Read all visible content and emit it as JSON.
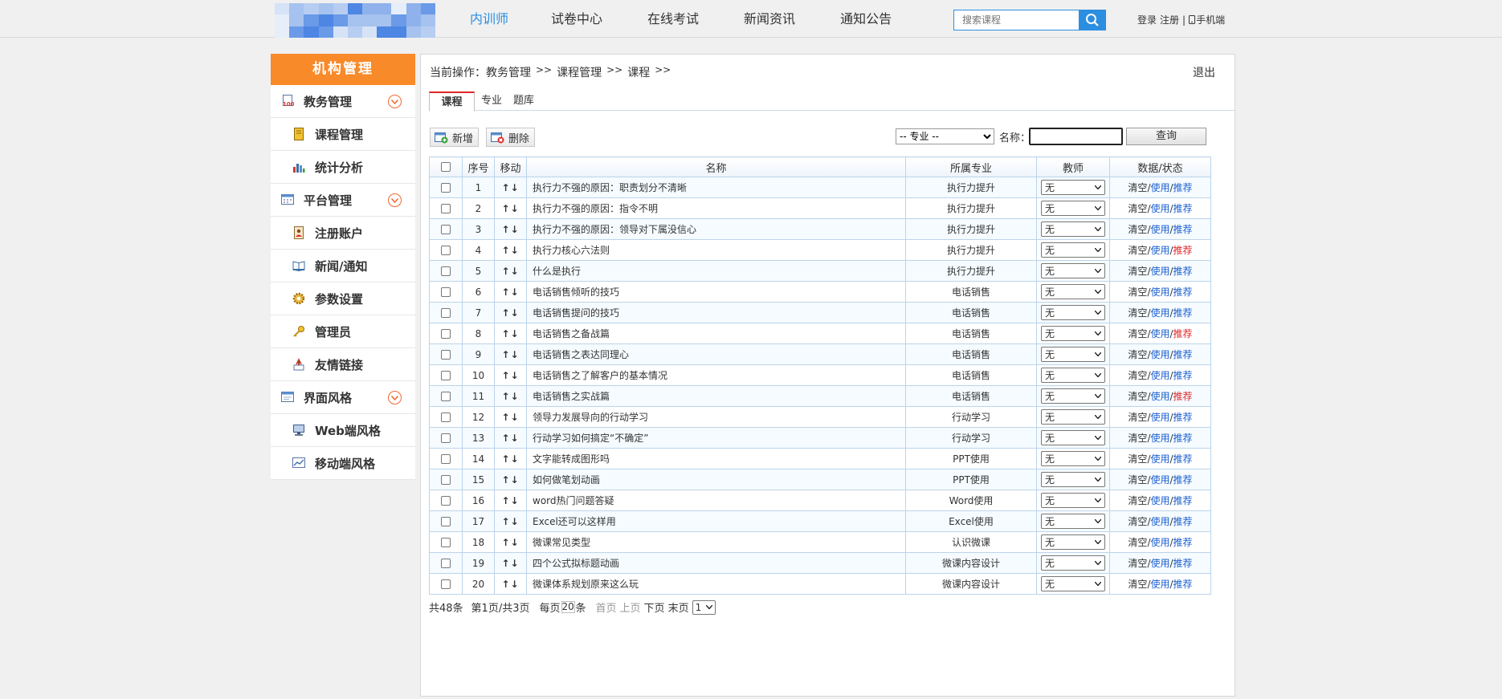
{
  "header": {
    "nav": [
      {
        "label": "内训师",
        "active": true
      },
      {
        "label": "试卷中心",
        "active": false
      },
      {
        "label": "在线考试",
        "active": false
      },
      {
        "label": "新闻资讯",
        "active": false
      },
      {
        "label": "通知公告",
        "active": false
      }
    ],
    "search_placeholder": "搜索课程",
    "login": "登录",
    "register": "注册",
    "divider": "|",
    "mobile": "手机端",
    "accent_color": "#2b8ee0"
  },
  "sidebar": {
    "title": "机构管理",
    "title_color": "#f88a2a",
    "groups": [
      {
        "label": "教务管理",
        "icon": "report-icon",
        "items": [
          {
            "label": "课程管理",
            "icon": "notebook-icon"
          },
          {
            "label": "统计分析",
            "icon": "bar-chart-icon"
          }
        ]
      },
      {
        "label": "平台管理",
        "icon": "calendar-icon",
        "items": [
          {
            "label": "注册账户",
            "icon": "contact-card-icon"
          },
          {
            "label": "新闻/通知",
            "icon": "open-book-icon"
          },
          {
            "label": "参数设置",
            "icon": "gear-icon"
          },
          {
            "label": "管理员",
            "icon": "key-icon"
          },
          {
            "label": "友情链接",
            "icon": "link-icon"
          }
        ]
      },
      {
        "label": "界面风格",
        "icon": "window-icon",
        "items": [
          {
            "label": "Web端风格",
            "icon": "monitor-icon"
          },
          {
            "label": "移动端风格",
            "icon": "line-chart-icon"
          }
        ]
      }
    ]
  },
  "breadcrumb": {
    "prefix": "当前操作：",
    "items": [
      "教务管理",
      "课程管理",
      "课程"
    ],
    "sep": ">>"
  },
  "logout": "退出",
  "tabs": [
    {
      "label": "课程",
      "active": true
    },
    {
      "label": "专业",
      "active": false
    },
    {
      "label": "题库",
      "active": false
    }
  ],
  "toolbar": {
    "add": "新增",
    "delete": "删除",
    "major_select": "-- 专业 --",
    "name_label": "名称：",
    "query": "查询"
  },
  "table": {
    "headers": [
      "",
      "序号",
      "移动",
      "名称",
      "所属专业",
      "教师",
      "数据/状态"
    ],
    "move_glyph": "↑↓",
    "teacher_default": "无",
    "action_clear": "清空",
    "action_use": "使用",
    "action_recommend": "推荐",
    "action_sep": "/",
    "rows": [
      {
        "no": "1",
        "name": "执行力不强的原因：职责划分不清晰",
        "major": "执行力提升",
        "recommended": false
      },
      {
        "no": "2",
        "name": "执行力不强的原因：指令不明",
        "major": "执行力提升",
        "recommended": false
      },
      {
        "no": "3",
        "name": "执行力不强的原因：领导对下属没信心",
        "major": "执行力提升",
        "recommended": false
      },
      {
        "no": "4",
        "name": "执行力核心六法则",
        "major": "执行力提升",
        "recommended": true
      },
      {
        "no": "5",
        "name": "什么是执行",
        "major": "执行力提升",
        "recommended": false
      },
      {
        "no": "6",
        "name": "电话销售倾听的技巧",
        "major": "电话销售",
        "recommended": false
      },
      {
        "no": "7",
        "name": "电话销售提问的技巧",
        "major": "电话销售",
        "recommended": false
      },
      {
        "no": "8",
        "name": "电话销售之备战篇",
        "major": "电话销售",
        "recommended": true
      },
      {
        "no": "9",
        "name": "电话销售之表达同理心",
        "major": "电话销售",
        "recommended": false
      },
      {
        "no": "10",
        "name": "电话销售之了解客户的基本情况",
        "major": "电话销售",
        "recommended": false
      },
      {
        "no": "11",
        "name": "电话销售之实战篇",
        "major": "电话销售",
        "recommended": true
      },
      {
        "no": "12",
        "name": "领导力发展导向的行动学习",
        "major": "行动学习",
        "recommended": false
      },
      {
        "no": "13",
        "name": "行动学习如何搞定“不确定”",
        "major": "行动学习",
        "recommended": false
      },
      {
        "no": "14",
        "name": "文字能转成图形吗",
        "major": "PPT使用",
        "recommended": false
      },
      {
        "no": "15",
        "name": "如何做笔划动画",
        "major": "PPT使用",
        "recommended": false
      },
      {
        "no": "16",
        "name": "word热门问题答疑",
        "major": "Word使用",
        "recommended": false
      },
      {
        "no": "17",
        "name": "Excel还可以这样用",
        "major": "Excel使用",
        "recommended": false
      },
      {
        "no": "18",
        "name": "微课常见类型",
        "major": "认识微课",
        "recommended": false
      },
      {
        "no": "19",
        "name": "四个公式拟标题动画",
        "major": "微课内容设计",
        "recommended": false
      },
      {
        "no": "20",
        "name": "微课体系规划原来这么玩",
        "major": "微课内容设计",
        "recommended": false
      }
    ]
  },
  "pager": {
    "total": "共48条",
    "page_info": "第1页/共3页",
    "per_page_prefix": "每页",
    "per_page": "20",
    "per_page_suffix": "条",
    "first": "首页",
    "prev": "上页",
    "next": "下页",
    "last": "末页",
    "current": "1"
  }
}
